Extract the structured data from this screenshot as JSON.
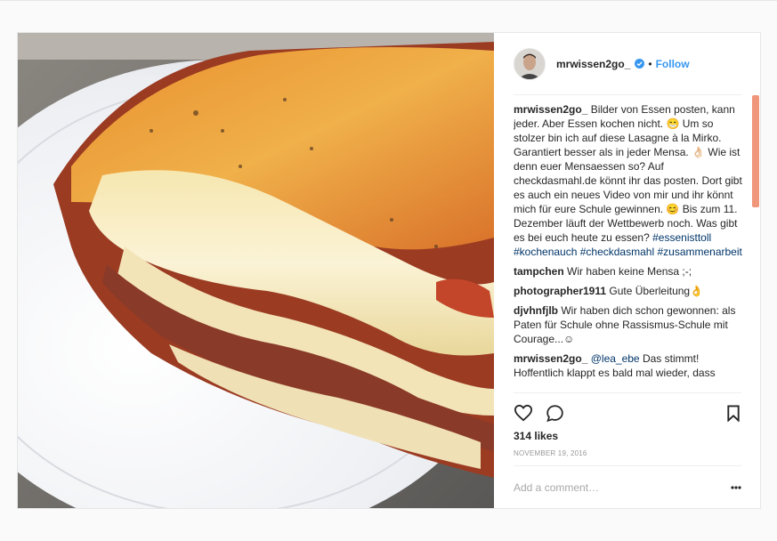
{
  "post": {
    "username": "mrwissen2go_",
    "follow_label": "Follow",
    "separator": "•",
    "likes": "314 likes",
    "date": "NOVEMBER 19, 2016",
    "add_comment_placeholder": "Add a comment…",
    "image_description": "lasagna-on-plate"
  },
  "caption": {
    "user": "mrwissen2go_",
    "text": "Bilder von Essen posten, kann jeder. Aber Essen kochen nicht. 😁 Um so stolzer bin ich auf diese Lasagne à la Mirko. Garantiert besser als in jeder Mensa. 👌🏻 Wie ist denn euer Mensaessen so? Auf checkdasmahl.de könnt ihr das posten. Dort gibt es auch ein neues Video von mir und ihr könnt mich für eure Schule gewinnen. 😊 Bis zum 11. Dezember läuft der Wettbewerb noch. Was gibt es bei euch heute zu essen?",
    "hashtags": [
      "#essenisttoll",
      "#kochenauch",
      "#checkdasmahl",
      "#zusammenarbeit"
    ]
  },
  "comments": [
    {
      "user": "tampchen",
      "text": "Wir haben keine Mensa ;-;"
    },
    {
      "user": "photographer1911",
      "text": "Gute Überleitung👌"
    },
    {
      "user": "djvhnfjlb",
      "text": "Wir haben dich schon gewonnen: als Paten für Schule ohne Rassismus-Schule mit Courage...☺"
    },
    {
      "user": "mrwissen2go_",
      "mention": "@lea_ebe",
      "text": "Das stimmt! Hoffentlich klappt es bald mal wieder, dass"
    }
  ],
  "icons": {
    "verified": "verified-badge-icon",
    "like": "heart-icon",
    "comment": "comment-bubble-icon",
    "save": "bookmark-icon",
    "more": "more-options-icon"
  },
  "colors": {
    "accent": "#3897f0",
    "hashtag": "#003569",
    "scrollbar": "#f0967a",
    "border": "#e6e6e6"
  }
}
